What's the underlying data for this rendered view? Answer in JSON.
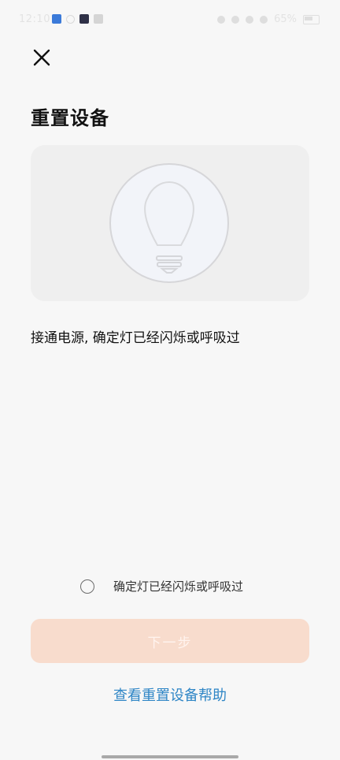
{
  "status_bar": {
    "time": "12:10",
    "battery": "65%"
  },
  "header": {
    "title": "重置设备"
  },
  "instruction": {
    "text": "接通电源, 确定灯已经闪烁或呼吸过"
  },
  "confirm": {
    "label": "确定灯已经闪烁或呼吸过",
    "checked": false
  },
  "buttons": {
    "next_label": "下一步",
    "help_link": "查看重置设备帮助"
  },
  "colors": {
    "background": "#f7f7f7",
    "next_button_disabled": "#f8dccd",
    "link": "#2f86c6"
  },
  "icons": {
    "close": "close-icon",
    "bulb": "light-bulb-icon"
  }
}
